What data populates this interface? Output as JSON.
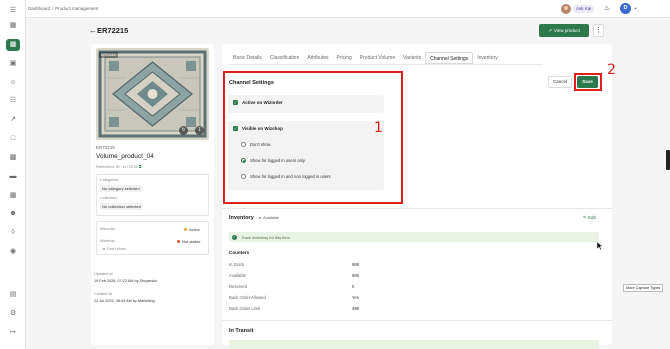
{
  "breadcrumb": {
    "root": "Dashboard",
    "separator": "/",
    "current": "Product management"
  },
  "topbar": {
    "ask_kai": "Ask Kai",
    "user_initial": "D"
  },
  "header": {
    "title": "ER72215",
    "view_product": "View product"
  },
  "product": {
    "image_badge": "ER72215",
    "sku": "ER72215",
    "name": "Volume_product_04",
    "reference": "Reference ID : er72215",
    "categories_label": "Categories",
    "categories_value": "No category selected",
    "collection_label": "Collection",
    "collection_value": "No collection selected",
    "wizorder_label": "Wizorder",
    "wizorder_status": "Active",
    "wizshop_label": "Wizshop",
    "wizshop_status": "Not visible",
    "wizshop_sub": "Don't show",
    "updated_label": "Updated at",
    "updated_value": "19 Feb 2026, 07:22 AM by Divyanshu",
    "created_label": "Created at",
    "created_value": "24 Jul 2025, 08:44 AM by Marketing"
  },
  "tabs": [
    "Basic Details",
    "Classification",
    "Attributes",
    "Pricing",
    "Product Volume",
    "Variants",
    "Channel Settings",
    "Inventory"
  ],
  "channel": {
    "title": "Channel Settings",
    "cancel": "Cancel",
    "save": "Save",
    "active_wizorder": "Active on Wizorder",
    "visible_wizshop": "Visible on Wizshop",
    "options": [
      "Don't show",
      "Show for logged in users only",
      "Show for logged in and non logged in users"
    ],
    "selected_option": 1
  },
  "annotations": {
    "one": "1",
    "two": "2"
  },
  "inventory": {
    "title": "Inventory",
    "status": "Available",
    "edit": "Edit",
    "track": "Track inventory for this item",
    "counters_title": "Counters",
    "counters": [
      {
        "label": "In Stock",
        "value": "989"
      },
      {
        "label": "Available",
        "value": "989"
      },
      {
        "label": "Reserved",
        "value": "0"
      },
      {
        "label": "Back Order Allowed",
        "value": "Yes"
      },
      {
        "label": "Back Order Limit",
        "value": "498"
      }
    ],
    "in_transit": "In Transit"
  },
  "tooltip": "More Capture Types"
}
